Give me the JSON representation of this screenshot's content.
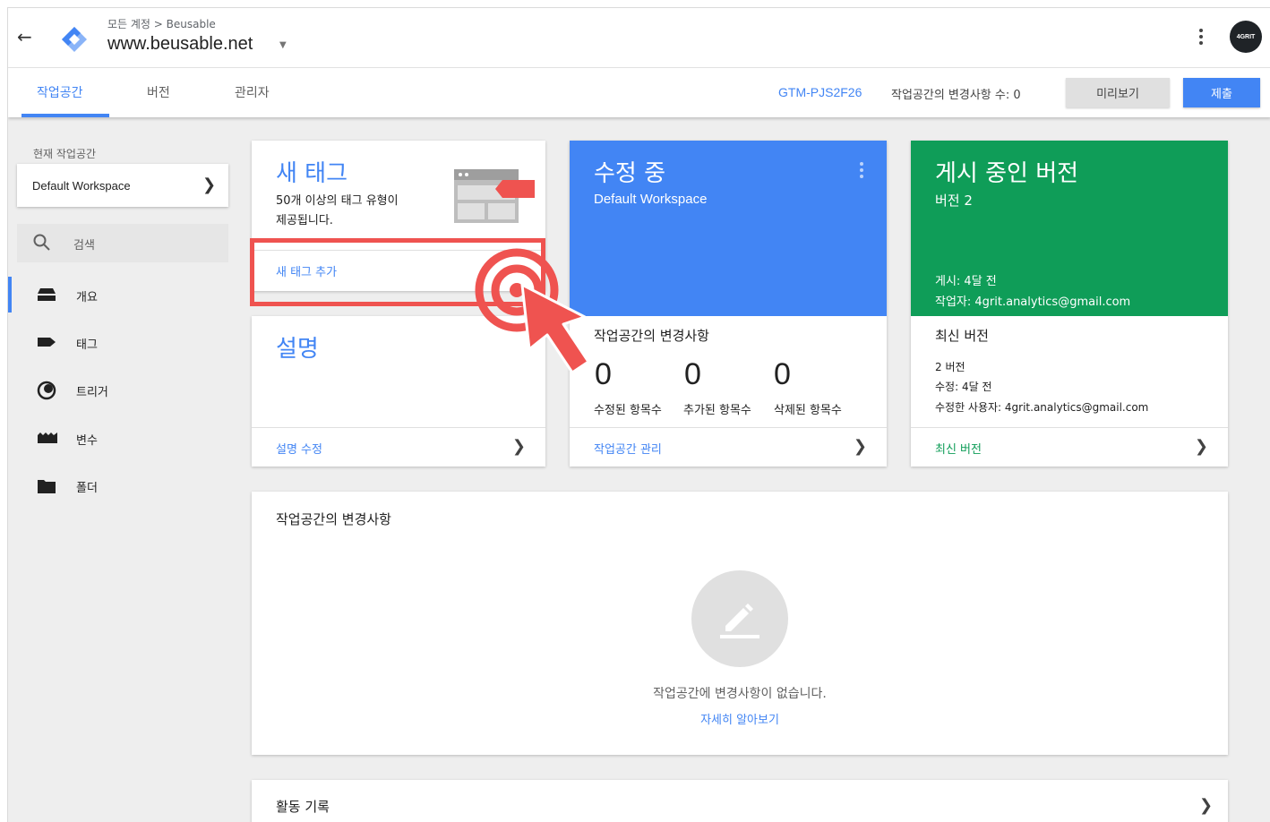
{
  "header": {
    "breadcrumb": "모든 계정 > Beusable",
    "site": "www.beusable.net",
    "avatar_text": "4GRIT"
  },
  "nav": {
    "tabs": [
      "작업공간",
      "버전",
      "관리자"
    ],
    "container_id": "GTM-PJS2F26",
    "changes_count": "작업공간의 변경사항 수: 0",
    "preview_label": "미리보기",
    "submit_label": "제출"
  },
  "sidebar": {
    "current_ws_label": "현재 작업공간",
    "workspace": "Default Workspace",
    "search_placeholder": "검색",
    "items": [
      {
        "label": "개요",
        "icon": "overview-icon"
      },
      {
        "label": "태그",
        "icon": "tag-icon"
      },
      {
        "label": "트리거",
        "icon": "trigger-icon"
      },
      {
        "label": "변수",
        "icon": "variable-icon"
      },
      {
        "label": "폴더",
        "icon": "folder-icon"
      }
    ]
  },
  "cards": {
    "new_tag": {
      "title": "새 태그",
      "desc_line1": "50개 이상의 태그 유형이",
      "desc_line2": "제공됩니다.",
      "link": "새 태그 추가"
    },
    "editing": {
      "title": "수정 중",
      "workspace": "Default Workspace"
    },
    "published": {
      "title": "게시 중인 버전",
      "version": "버전 2",
      "published_at": "게시: 4달 전",
      "author": "작업자: 4grit.analytics@gmail.com"
    },
    "description": {
      "title": "설명",
      "link": "설명 수정"
    },
    "ws_changes": {
      "title": "작업공간의 변경사항",
      "modified_count": "0",
      "added_count": "0",
      "deleted_count": "0",
      "modified_label": "수정된 항목수",
      "added_label": "추가된 항목수",
      "deleted_label": "삭제된 항목수",
      "link": "작업공간 관리"
    },
    "latest": {
      "title": "최신 버전",
      "version": "2 버전",
      "modified": "수정: 4달 전",
      "modified_by": "수정한 사용자: 4grit.analytics@gmail.com",
      "link": "최신 버전"
    }
  },
  "changes_panel": {
    "title": "작업공간의 변경사항",
    "empty_text": "작업공간에 변경사항이 없습니다.",
    "learn_more": "자세히 알아보기"
  },
  "activity": {
    "title": "활동 기록"
  },
  "colors": {
    "accent": "#4285f4",
    "editing_bg": "#4285f4",
    "published_bg": "#0f9d58",
    "highlight": "#ef5350"
  }
}
